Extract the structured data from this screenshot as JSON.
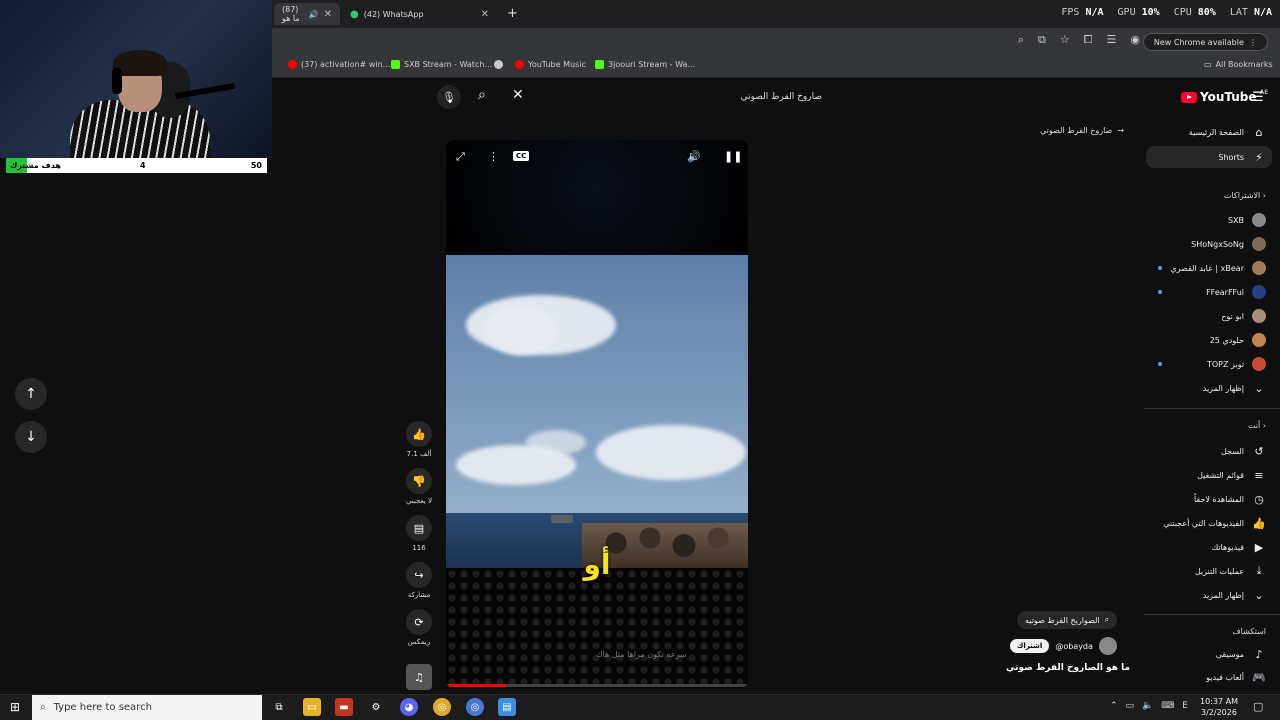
{
  "browser": {
    "tabs": [
      {
        "label": "(87) ما هو",
        "active": true
      },
      {
        "label": "(42) WhatsApp",
        "active": false
      }
    ],
    "new_tab": "+",
    "new_chrome_label": "New Chrome available",
    "bookmarks": [
      "(37) activation# win...",
      "SXB Stream - Watch...",
      "YouTube Music",
      "3joouri Stream - Wa..."
    ],
    "all_bookmarks": "All Bookmarks"
  },
  "perf": {
    "fps_label": "FPS",
    "fps": "N/A",
    "gpu_label": "GPU",
    "gpu": "10%",
    "cpu_label": "CPU",
    "cpu": "80%",
    "lat_label": "LAT",
    "lat": "N/A"
  },
  "stream_goal": {
    "label": "هدف مشترك",
    "current": "4",
    "target": "50",
    "progress": 0.08
  },
  "search": {
    "query": "صاروخ الفرط الصوتي"
  },
  "logo": {
    "text": "YouTube",
    "region": "AE"
  },
  "back_link": "صاروخ الفرط الصوتي",
  "sidebar": {
    "main": [
      {
        "label": "الصفحة الرئيسية",
        "icon": "home-icon"
      },
      {
        "label": "Shorts",
        "icon": "shorts-icon",
        "active": true
      }
    ],
    "subscriptions_header": "الاشتراكات",
    "subscriptions": [
      {
        "label": "SXB",
        "color": "#8a8a8a",
        "live": false
      },
      {
        "label": "SHoNgxSoNg",
        "color": "#7d6b5a",
        "live": false
      },
      {
        "label": "عابد القصري | xBear",
        "color": "#a07a5d",
        "live": true
      },
      {
        "label": "FFearFFul",
        "color": "#2a3f88",
        "live": true
      },
      {
        "label": "ابو نوح",
        "color": "#a98f7a",
        "live": false
      },
      {
        "label": "حلودي 25",
        "color": "#c0854f",
        "live": false
      },
      {
        "label": "TOPZ توبز",
        "color": "#c44d3a",
        "live": true
      }
    ],
    "show_more_1": "إظهار المزيد",
    "you_header": "أنت",
    "you": [
      {
        "label": "السجل",
        "icon": "history-icon"
      },
      {
        "label": "قوائم التشغيل",
        "icon": "playlist-icon"
      },
      {
        "label": "المشاهدة لاحقاً",
        "icon": "clock-icon"
      },
      {
        "label": "الفيديوهات التي أعجبتني",
        "icon": "like-icon"
      },
      {
        "label": "فيديوهاتك",
        "icon": "video-icon"
      },
      {
        "label": "عمليات التنزيل",
        "icon": "download-icon"
      }
    ],
    "show_more_2": "إظهار المزيد",
    "explore_header": "استكشاف",
    "explore": [
      {
        "label": "موسيقى",
        "icon": "music-icon"
      },
      {
        "label": "ألعاب فيديو",
        "icon": "gamepad-icon"
      }
    ]
  },
  "player": {
    "caption": "أو",
    "subtitle": "سرعه تكون مراها مثل هاك",
    "progress": 0.2
  },
  "actions": {
    "like_count": "7.1 ألف",
    "dislike_label": "لا يعجبني",
    "comments_count": "116",
    "share_label": "مشاركة",
    "remix_label": "ريمكس"
  },
  "video_meta": {
    "search_chip": "الصواريخ الفرط صوتيه",
    "channel": "@obayda",
    "subscribe": "اشتراك",
    "title": "ما هو الصاروخ الفرط صوتي"
  },
  "taskbar": {
    "search_placeholder": "Type here to search",
    "time": "10:37 AM",
    "date": "3/2/2026",
    "lang": "E"
  }
}
